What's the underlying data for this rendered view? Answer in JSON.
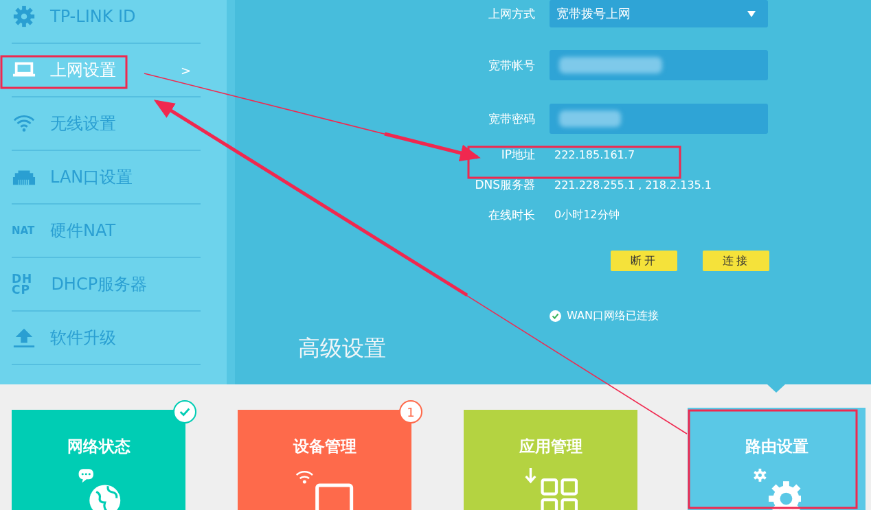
{
  "sidebar": {
    "items": [
      {
        "label": "TP-LINK ID",
        "selected": false
      },
      {
        "label": "上网设置",
        "selected": true,
        "chevron": ">"
      },
      {
        "label": "无线设置",
        "selected": false
      },
      {
        "label": "LAN口设置",
        "selected": false
      },
      {
        "icon_text": "NAT",
        "label": "硬件NAT",
        "selected": false
      },
      {
        "icon_text": "DHCP",
        "label": "DHCP服务器",
        "selected": false
      },
      {
        "label": "软件升级",
        "selected": false
      }
    ]
  },
  "connection_form": {
    "rows": [
      {
        "kind": "select",
        "label": "上网方式",
        "value": "宽带拨号上网"
      },
      {
        "kind": "masked",
        "label": "宽带帐号"
      },
      {
        "kind": "masked",
        "label": "宽带密码"
      },
      {
        "kind": "text",
        "label": "IP地址",
        "value": "222.185.161.7"
      },
      {
        "kind": "text",
        "label": "DNS服务器",
        "value": "221.228.255.1 , 218.2.135.1"
      },
      {
        "kind": "text",
        "label": "在线时长",
        "value": "0小时12分钟"
      }
    ],
    "buttons": [
      "断开",
      "连接"
    ],
    "status": {
      "text": "WAN口网络已连接",
      "connected": true
    }
  },
  "advanced": {
    "title": "高级设置",
    "tiles": [
      {
        "label": "网络状态",
        "color": "#00cdb4",
        "checked": true,
        "selected": false
      },
      {
        "label": "设备管理",
        "color": "#fe6a4b",
        "checked": false,
        "badge_text": "1",
        "selected": false
      },
      {
        "label": "应用管理",
        "color": "#b4d341",
        "checked": false,
        "selected": false
      },
      {
        "label": "路由设置",
        "color": "#5ac8e6",
        "checked": false,
        "selected": true
      }
    ]
  }
}
